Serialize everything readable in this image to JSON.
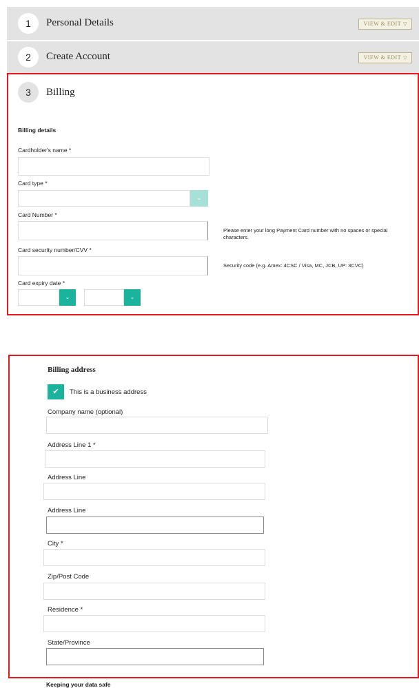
{
  "steps": [
    {
      "number": "1",
      "title": "Personal Details",
      "action": "VIEW & EDIT"
    },
    {
      "number": "2",
      "title": "Create Account",
      "action": "VIEW & EDIT"
    },
    {
      "number": "3",
      "title": "Billing"
    }
  ],
  "billing": {
    "section_title": "Billing details",
    "cardholder_label": "Cardholder's name *",
    "cardholder_value": "",
    "card_type_label": "Card type *",
    "card_type_value": "",
    "card_number_label": "Card Number *",
    "card_number_value": "",
    "card_number_hint": "Please enter your long Payment Card number with no spaces or special characters.",
    "cvv_label": "Card security number/CVV *",
    "cvv_value": "",
    "cvv_hint": "Security code (e.g. Amex: 4CSC / Visa, MC, JCB, UP: 3CVC)",
    "expiry_label": "Card expiry date *",
    "expiry_month": "",
    "expiry_year": ""
  },
  "address": {
    "section_title": "Billing address",
    "business_checkbox_label": "This is a business address",
    "business_checked": true,
    "company_label": "Company name (optional)",
    "address1_label": "Address Line 1 *",
    "address2_label": "Address Line",
    "address3_label": "Address Line",
    "city_label": "City *",
    "zip_label": "Zip/Post Code",
    "residence_label": "Residence *",
    "state_label": "State/Province"
  },
  "footer": {
    "safe_title": "Keeping your data safe"
  },
  "colors": {
    "teal": "#1bb39c",
    "teal_light": "#a7e0d6",
    "highlight_red": "#e5161d",
    "header_gray": "#e3e3e3",
    "view_edit_gold": "#9a8f5c"
  },
  "icons": {
    "checkbox": "checkmark-icon",
    "select": "chevron-down-icon"
  }
}
